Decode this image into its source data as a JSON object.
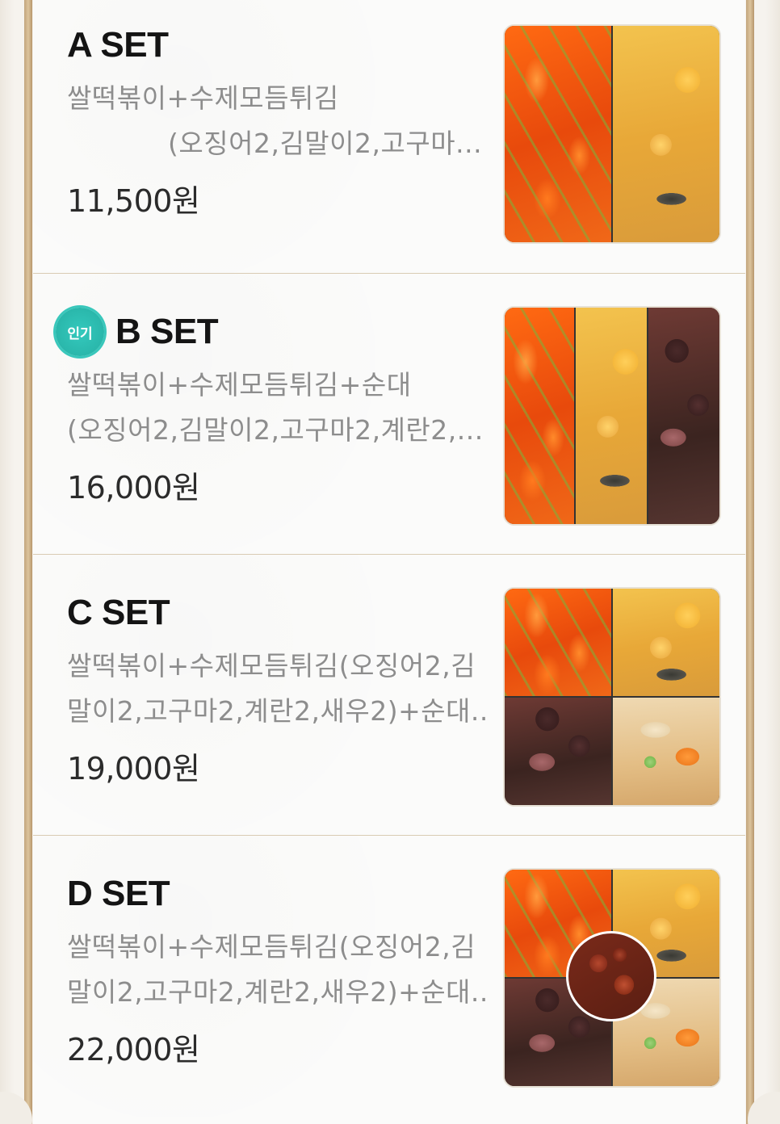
{
  "menu": {
    "items": [
      {
        "name": "A SET",
        "badge": "",
        "desc_line1": "쌀떡볶이+수제모듬튀김",
        "desc_line2": "(오징어2,김말이2,고구마...",
        "price": "11,500원"
      },
      {
        "name": "B SET",
        "badge": "인기",
        "desc_line1": "쌀떡볶이+수제모듬튀김+순대",
        "desc_line2": "(오징어2,김말이2,고구마2,계란2,...",
        "price": "16,000원"
      },
      {
        "name": "C SET",
        "badge": "",
        "desc_line1": "쌀떡볶이+수제모듬튀김(오징어2,김",
        "desc_line2": "말이2,고구마2,계란2,새우2)+순대...",
        "price": "19,000원"
      },
      {
        "name": "D SET",
        "badge": "",
        "desc_line1": "쌀떡볶이+수제모듬튀김(오징어2,김",
        "desc_line2": "말이2,고구마2,계란2,새우2)+순대...",
        "price": "22,000원"
      }
    ]
  },
  "colors": {
    "frame": "#c9ad86",
    "badge": "#2fbeb2",
    "name_text": "#141414",
    "desc_text": "#8d8d8d",
    "price_text": "#2b2b2b",
    "divider": "#d9cbb3"
  }
}
